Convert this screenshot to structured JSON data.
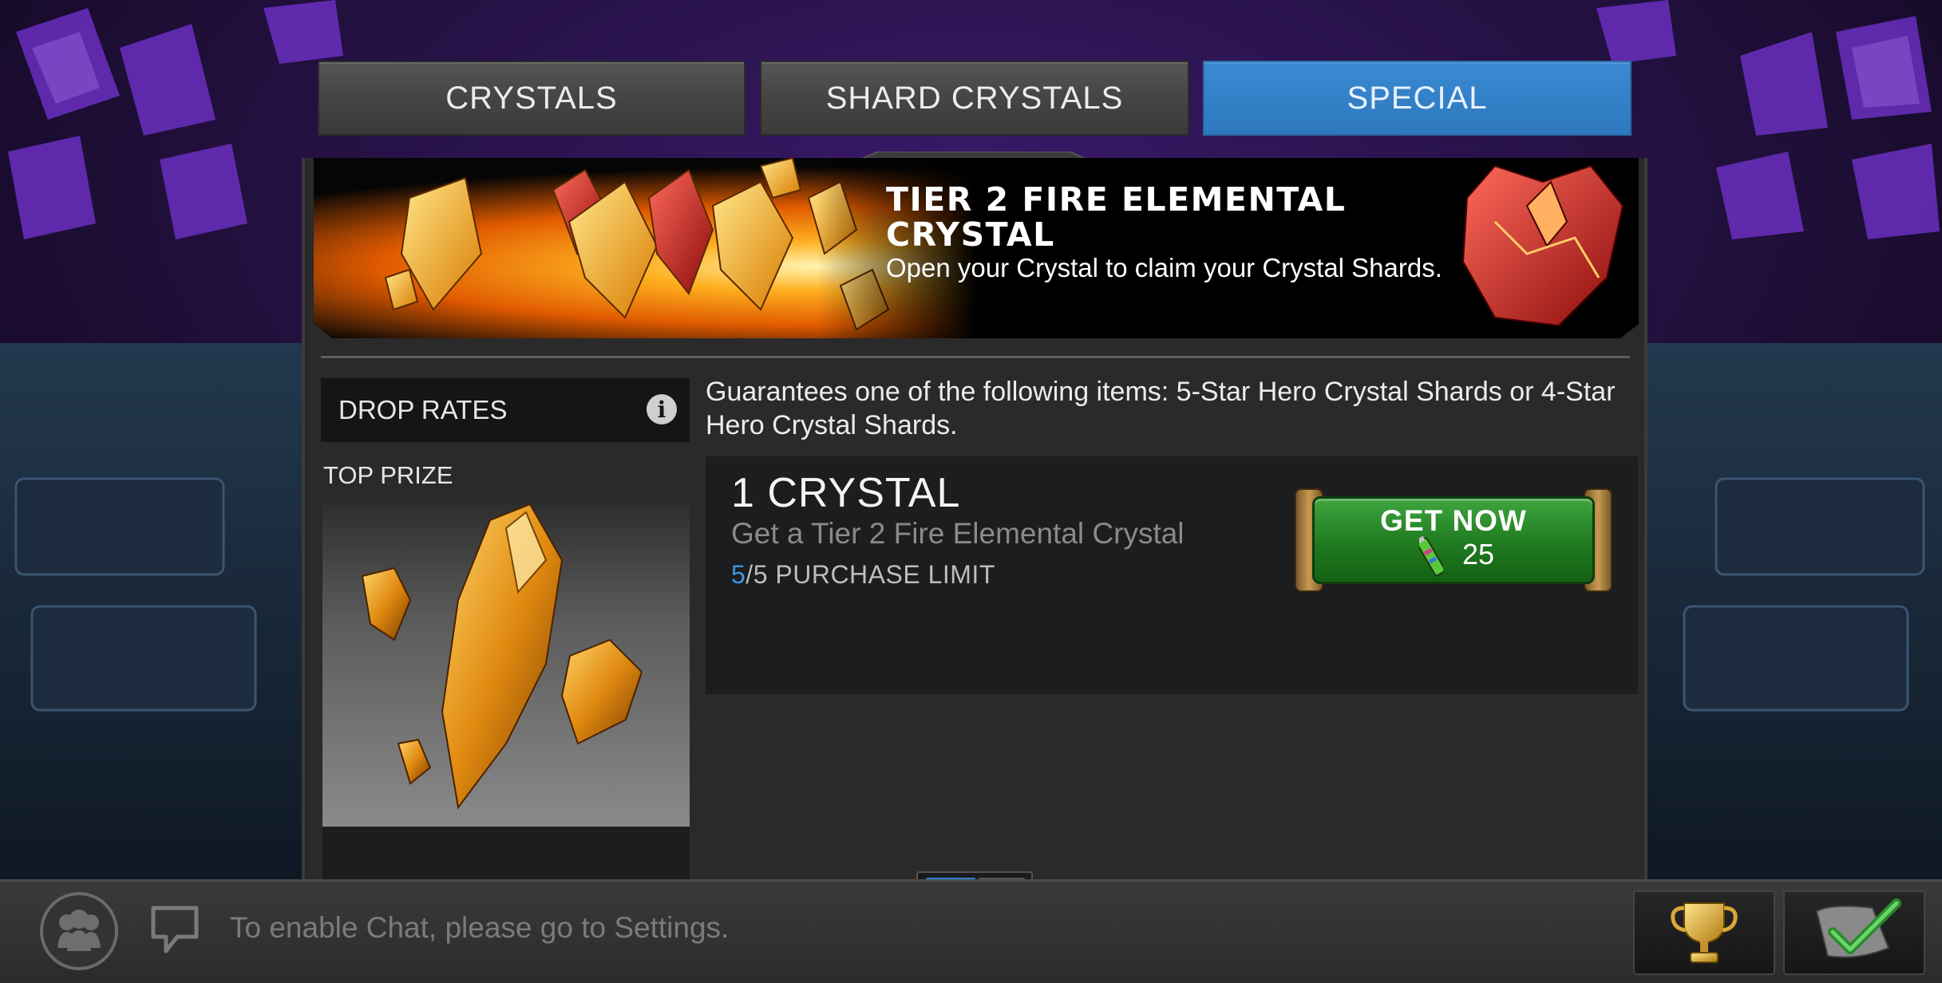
{
  "tabs": [
    {
      "label": "CRYSTALS",
      "active": false
    },
    {
      "label": "SHARD CRYSTALS",
      "active": false
    },
    {
      "label": "SPECIAL",
      "active": true
    }
  ],
  "banner": {
    "title": "TIER 2 FIRE ELEMENTAL CRYSTAL",
    "description": "Open your Crystal to claim your Crystal Shards."
  },
  "drop_rates": {
    "label": "DROP RATES",
    "info_icon": "info-icon"
  },
  "top_prize": {
    "label": "TOP PRIZE"
  },
  "guarantee_text": "Guarantees one of the following items: 5-Star Hero Crystal Shards or 4-Star Hero Crystal Shards.",
  "offer": {
    "title": "1 CRYSTAL",
    "subtitle": "Get a Tier 2 Fire Elemental Crystal",
    "limit_current": "5",
    "limit_rest": "/5 PURCHASE LIMIT",
    "button_label": "GET NOW",
    "price": "25",
    "currency_icon": "battery-icon"
  },
  "chat": {
    "hint": "To enable Chat, please go to Settings."
  },
  "bottom_icons": [
    "people-icon",
    "chat-icon",
    "trophy-icon",
    "quest-check-icon"
  ],
  "colors": {
    "accent": "#2e78bf",
    "buy": "#1f7a1f",
    "limit": "#3a97e6"
  }
}
